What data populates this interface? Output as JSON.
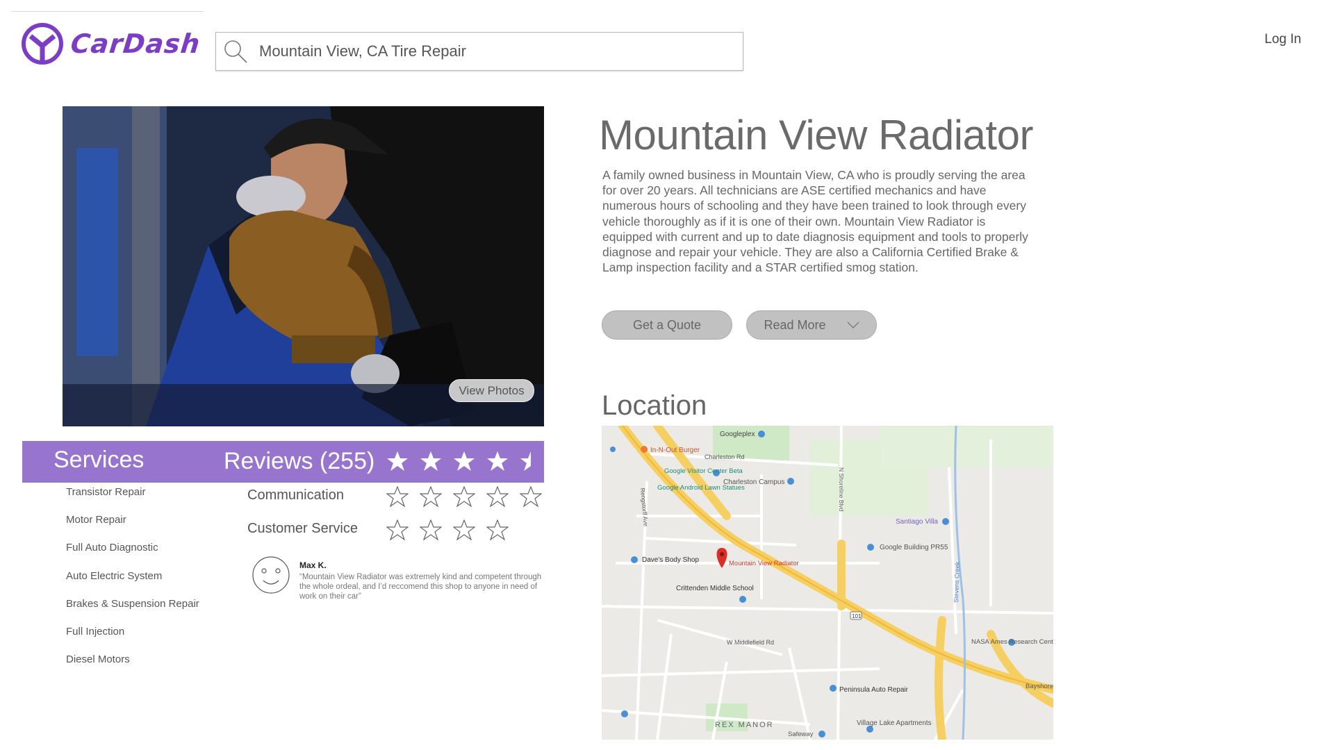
{
  "header": {
    "brand": "CarDash",
    "search_value": "Mountain View, CA Tire Repair",
    "login": "Log In"
  },
  "gallery": {
    "view_photos": "View Photos"
  },
  "tabs": {
    "services": "Services",
    "reviews": "Reviews (255)",
    "overall_rating": 4.5
  },
  "services": [
    "Transistor Repair",
    "Motor Repair",
    "Full Auto Diagnostic",
    "Auto Electric System",
    "Brakes & Suspension Repair",
    "Full Injection",
    "Diesel Motors"
  ],
  "ratings": [
    {
      "label": "Communication",
      "stars": 5
    },
    {
      "label": "Customer Service",
      "stars": 4
    }
  ],
  "review": {
    "author": "Max K.",
    "text": "“Mountain View Radiator was extremely kind and competent through the whole ordeal, and I’d reccomend this shop to anyone in need of work on their car”"
  },
  "business": {
    "name": "Mountain View Radiator",
    "description": "A family owned business in Mountain View, CA who is proudly serving the area for over 20 years. All technicians are ASE certified mechanics and have numerous hours of schooling and they have been trained to look through every vehicle thoroughly as if it is one of their own. Mountain View Radiator is equipped with current and up to date diagnosis equipment and tools to properly diagnose and repair your vehicle. They are also a California Certified Brake & Lamp inspection facility and a STAR certified smog station.",
    "quote_button": "Get a Quote",
    "read_more_button": "Read More"
  },
  "location": {
    "title": "Location",
    "map_labels": {
      "googleplex": "Googleplex",
      "in_n_out": "In-N-Out Burger",
      "charleston_rd": "Charleston Rd",
      "visitor_center": "Google Visitor Center Beta",
      "android_statues": "Google Android Lawn Statues",
      "charleston_campus": "Charleston Campus",
      "santiago_villa": "Santiago Villa",
      "building_pr55": "Google Building PR55",
      "daves": "Dave's Body Shop",
      "mvr": "Mountain View Radiator",
      "crittenden": "Crittenden Middle School",
      "middlefield": "W Middlefield Rd",
      "nasa_ames": "NASA Ames Research Center",
      "peninsula": "Peninsula Auto Repair",
      "rex_manor": "REX MANOR",
      "village_lake": "Village Lake Apartments",
      "safeway": "Safeway",
      "bayshore": "Bayshore",
      "stevens_creek": "Stevens Creek",
      "shoreline": "N Shoreline Blvd",
      "rengstorff": "Rengstorff Ave",
      "hwy_101": "101"
    }
  },
  "colors": {
    "brand": "#7b3cc6",
    "band": "#9775cf"
  }
}
